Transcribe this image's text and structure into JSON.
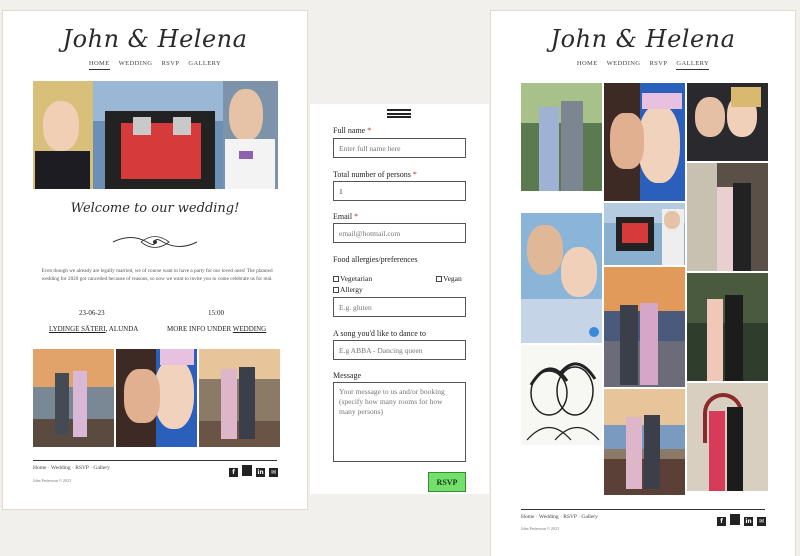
{
  "brand": "John & Helena",
  "nav": [
    "HOME",
    "WEDDING",
    "RSVP",
    "GALLERY"
  ],
  "home": {
    "welcome": "Welcome to our wedding!",
    "paragraph": "Even though we already are legally married, we of course want to have a party for our loved ones! The planned wedding for 2020 got cancelled because of reasons, so now we want to invite you to come celebrate us for real.",
    "date": "23-06-23",
    "time": "15:00",
    "venue_link": "LYDINGE SÄTERI",
    "venue_city": ", ALUNDA",
    "more_info_prefix": "MORE INFO UNDER ",
    "more_info_link": "WEDDING"
  },
  "footer": {
    "links": "Home · Wedding · RSVP · Gallery",
    "copyright": "John Pettersson © 2023"
  },
  "socials": [
    "f",
    "",
    "in",
    "✉"
  ],
  "rsvp": {
    "full_name_label": "Full name",
    "full_name_placeholder": "Enter full name here",
    "persons_label": "Total number of persons",
    "persons_value": "1",
    "email_label": "Email",
    "email_placeholder": "email@hotmail.com",
    "food_label": "Food allergies/preferences",
    "vegetarian": "Vegetarian",
    "vegan": "Vegan",
    "allergy": "Allergy",
    "allergy_placeholder": "E.g. gluten",
    "song_label": "A song you'd like to dance to",
    "song_placeholder": "E.g ABBA - Dancing queen",
    "message_label": "Message",
    "message_placeholder": "Your message to us and/or booking (specify how many rooms for how many persons)",
    "required_mark": "*",
    "submit": "RSVP"
  }
}
